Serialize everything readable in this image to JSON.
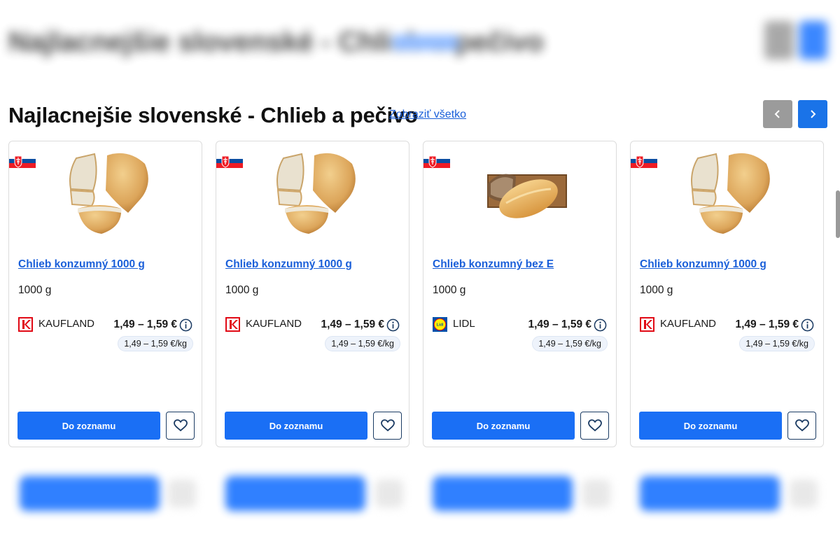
{
  "section": {
    "title": "Najlacnejšie slovenské - Chlieb a pečivo",
    "show_all": "Zobraziť všetko"
  },
  "products": [
    {
      "name": "Chlieb konzumný 1000 g",
      "weight": "1000 g",
      "store": "KAUFLAND",
      "store_logo": "kaufland-logo",
      "price": "1,49 – 1,59 €",
      "unit_price": "1,49 – 1,59 €/kg",
      "add_label": "Do zoznamu",
      "image": "round-bread-sliced"
    },
    {
      "name": "Chlieb konzumný 1000 g",
      "weight": "1000 g",
      "store": "KAUFLAND",
      "store_logo": "kaufland-logo",
      "price": "1,49 – 1,59 €",
      "unit_price": "1,49 – 1,59 €/kg",
      "add_label": "Do zoznamu",
      "image": "round-bread-sliced"
    },
    {
      "name": "Chlieb konzumný bez E",
      "weight": "1000 g",
      "store": "LIDL",
      "store_logo": "lidl-logo",
      "price": "1,49 – 1,59 €",
      "unit_price": "1,49 – 1,59 €/kg",
      "add_label": "Do zoznamu",
      "image": "oval-bread-on-board"
    },
    {
      "name": "Chlieb konzumný 1000 g",
      "weight": "1000 g",
      "store": "KAUFLAND",
      "store_logo": "kaufland-logo",
      "price": "1,49 – 1,59 €",
      "unit_price": "1,49 – 1,59 €/kg",
      "add_label": "Do zoznamu",
      "image": "round-bread-sliced"
    }
  ],
  "colors": {
    "accent": "#1a6ff5",
    "link": "#1a5fd9",
    "nav_prev": "#9b9b9b",
    "kaufland": "#e10915",
    "lidl_blue": "#0050aa",
    "lidl_yellow": "#fff000"
  }
}
